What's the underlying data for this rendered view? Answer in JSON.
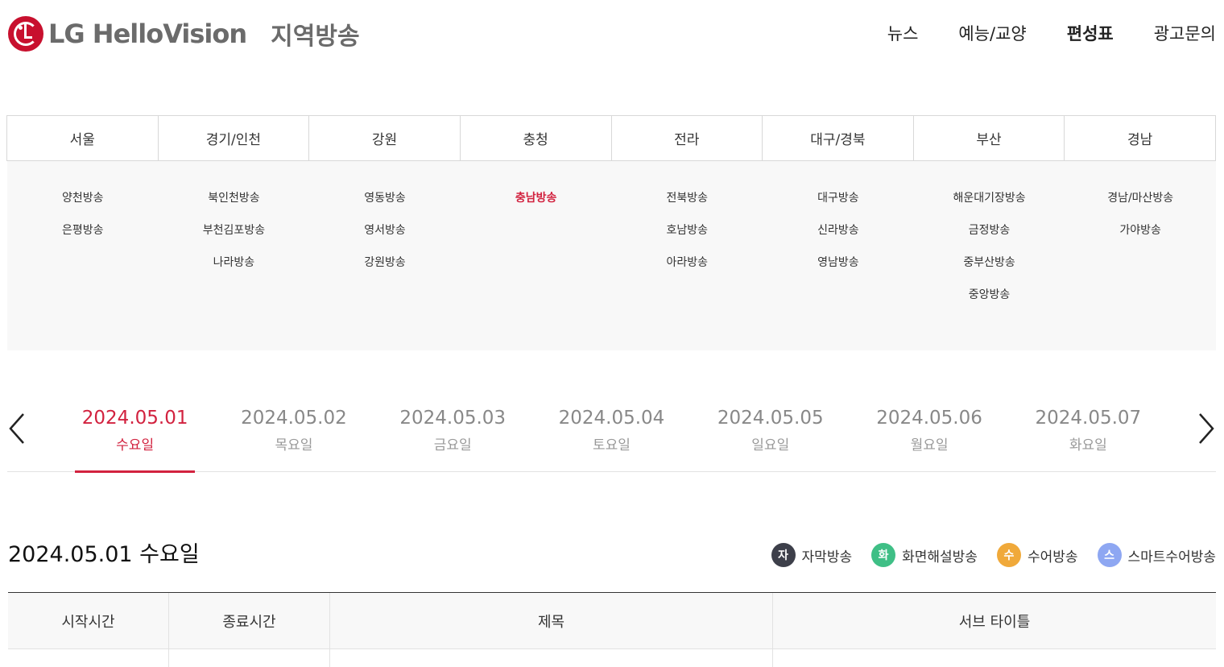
{
  "header": {
    "logo_text": "LG HelloVision",
    "logo_sub": "지역방송",
    "nav": [
      {
        "label": "뉴스",
        "active": false
      },
      {
        "label": "예능/교양",
        "active": false
      },
      {
        "label": "편성표",
        "active": true
      },
      {
        "label": "광고문의",
        "active": false
      }
    ]
  },
  "regions": [
    "서울",
    "경기/인천",
    "강원",
    "충청",
    "전라",
    "대구/경북",
    "부산",
    "경남"
  ],
  "channels": [
    [
      "양천방송",
      "은평방송"
    ],
    [
      "북인천방송",
      "부천김포방송",
      "나라방송"
    ],
    [
      "영동방송",
      "영서방송",
      "강원방송"
    ],
    [
      "충남방송"
    ],
    [
      "전북방송",
      "호남방송",
      "아라방송"
    ],
    [
      "대구방송",
      "신라방송",
      "영남방송"
    ],
    [
      "해운대기장방송",
      "금정방송",
      "중부산방송",
      "중앙방송"
    ],
    [
      "경남/마산방송",
      "가야방송"
    ]
  ],
  "active_channel": "충남방송",
  "dates": [
    {
      "date": "2024.05.01",
      "day": "수요일"
    },
    {
      "date": "2024.05.02",
      "day": "목요일"
    },
    {
      "date": "2024.05.03",
      "day": "금요일"
    },
    {
      "date": "2024.05.04",
      "day": "토요일"
    },
    {
      "date": "2024.05.05",
      "day": "일요일"
    },
    {
      "date": "2024.05.06",
      "day": "월요일"
    },
    {
      "date": "2024.05.07",
      "day": "화요일"
    }
  ],
  "active_date_index": 0,
  "selected_date_label": "2024.05.01 수요일",
  "legend": [
    {
      "badge": "자",
      "label": "자막방송",
      "color": "#3d3f4a"
    },
    {
      "badge": "화",
      "label": "화면해설방송",
      "color": "#3fbf86"
    },
    {
      "badge": "수",
      "label": "수어방송",
      "color": "#f0a93a"
    },
    {
      "badge": "스",
      "label": "스마트수어방송",
      "color": "#8ea7f2"
    }
  ],
  "table": {
    "headers": [
      "시작시간",
      "종료시간",
      "제목",
      "서브 타이틀"
    ]
  },
  "colors": {
    "accent": "#d2223f",
    "brand": "#c8102e"
  }
}
